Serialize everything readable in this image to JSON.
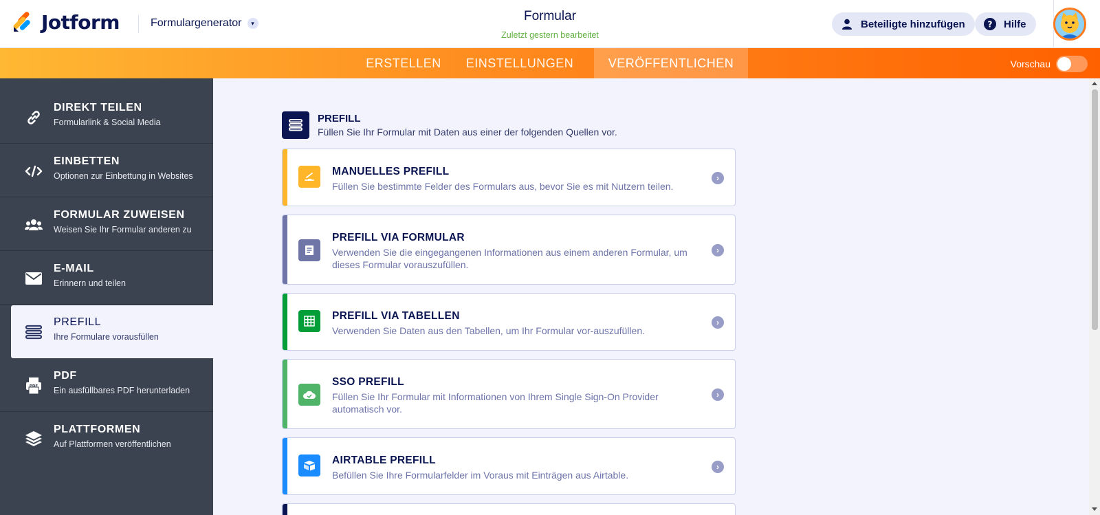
{
  "header": {
    "logo_text": "Jotform",
    "builder_label": "Formulargenerator",
    "form_title": "Formular",
    "form_status": "Zuletzt gestern bearbeitet",
    "add_participants_label": "Beteiligte hinzufügen",
    "help_label": "Hilfe"
  },
  "nav": {
    "tabs": [
      {
        "label": "ERSTELLEN"
      },
      {
        "label": "EINSTELLUNGEN"
      },
      {
        "label": "VERÖFFENTLICHEN",
        "active": true
      }
    ],
    "preview_label": "Vorschau",
    "preview_on": false
  },
  "sidebar": {
    "items": [
      {
        "title": "DIREKT TEILEN",
        "subtitle": "Formularlink & Social Media",
        "icon": "link-icon"
      },
      {
        "title": "EINBETTEN",
        "subtitle": "Optionen zur Einbettung in Websites",
        "icon": "code-icon"
      },
      {
        "title": "FORMULAR ZUWEISEN",
        "subtitle": "Weisen Sie Ihr Formular anderen zu",
        "icon": "users-icon"
      },
      {
        "title": "E-MAIL",
        "subtitle": "Erinnern und teilen",
        "icon": "envelope-icon"
      },
      {
        "title": "PREFILL",
        "subtitle": "Ihre Formulare vorausfüllen",
        "icon": "prefill-icon",
        "active": true
      },
      {
        "title": "PDF",
        "subtitle": "Ein ausfüllbares PDF herunterladen",
        "icon": "pdf-icon"
      },
      {
        "title": "PLATTFORMEN",
        "subtitle": "Auf Plattformen veröffentlichen",
        "icon": "layers-icon"
      }
    ]
  },
  "section": {
    "title": "PREFILL",
    "subtitle": "Füllen Sie Ihr Formular mit Daten aus einer der folgenden Quellen vor."
  },
  "cards": [
    {
      "title": "MANUELLES PREFILL",
      "description": "Füllen Sie bestimmte Felder des Formulars aus, bevor Sie es mit Nutzern teilen.",
      "accent": "#ffb629",
      "icon": "pen-icon"
    },
    {
      "title": "PREFILL VIA FORMULAR",
      "description": "Verwenden Sie die eingegangenen Informationen aus einem anderen Formular, um dieses Formular vorauszufüllen.",
      "accent": "#6f76a7",
      "icon": "form-icon"
    },
    {
      "title": "PREFILL VIA TABELLEN",
      "description": "Verwenden Sie Daten aus den Tabellen, um Ihr Formular vor-auszufüllen.",
      "accent": "#049e38",
      "icon": "table-icon"
    },
    {
      "title": "SSO PREFILL",
      "description": "Füllen Sie Ihr Formular mit Informationen von Ihrem Single Sign-On Provider automatisch vor.",
      "accent": "#4fb468",
      "icon": "sso-icon"
    },
    {
      "title": "AIRTABLE PREFILL",
      "description": "Befüllen Sie Ihre Formularfelder im Voraus mit Einträgen aus Airtable.",
      "accent": "#1a8cff",
      "icon": "airtable-icon"
    }
  ],
  "colors": {
    "brand_navy": "#0a1551",
    "orange_start": "#ffb833",
    "orange_end": "#ff6100",
    "sidebar_bg": "#3a434f",
    "page_bg": "#f3f3fe"
  }
}
